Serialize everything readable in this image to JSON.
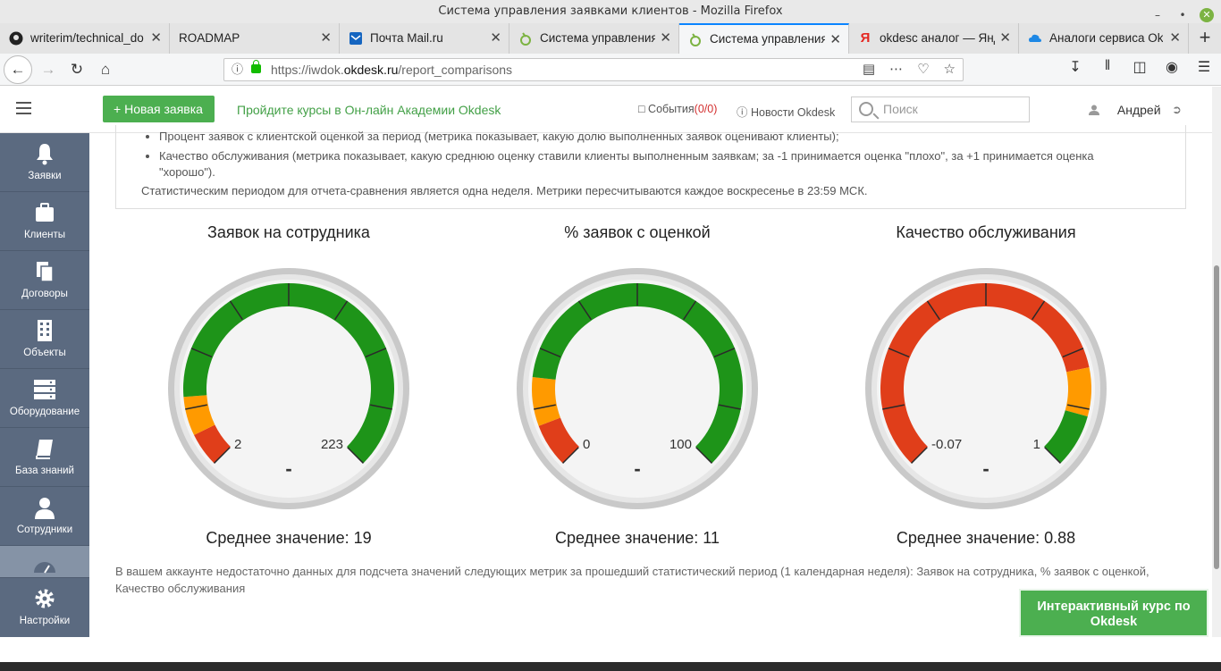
{
  "window": {
    "title": "Система управления заявками клиентов - Mozilla Firefox"
  },
  "tabs": [
    {
      "label": "writerim/technical_do"
    },
    {
      "label": "ROADMAP"
    },
    {
      "label": "Почта Mail.ru"
    },
    {
      "label": "Система управления"
    },
    {
      "label": "Система управления"
    },
    {
      "label": "okdesc аналог — Янд"
    },
    {
      "label": "Аналоги сервиса Ok"
    }
  ],
  "address": {
    "prefix": "https://iwdok.",
    "domain": "okdesk.ru",
    "path": "/report_comparisons"
  },
  "header": {
    "new_request": "Новая заявка",
    "courses_link": "Пройдите курсы в Он-лайн Академии Okdesk",
    "events_label": "События",
    "events_count": "(0/0)",
    "news_label": "Новости Okdesk",
    "search_placeholder": "Поиск",
    "user_name": "Андрей"
  },
  "sidebar": {
    "items": [
      {
        "label": "Заявки"
      },
      {
        "label": "Клиенты"
      },
      {
        "label": "Договоры"
      },
      {
        "label": "Объекты"
      },
      {
        "label": "Оборудование"
      },
      {
        "label": "База знаний"
      },
      {
        "label": "Сотрудники"
      },
      {
        "label": ""
      },
      {
        "label": "Настройки"
      }
    ]
  },
  "info": {
    "bullets": [
      "Процент заявок с клиентской оценкой за период (метрика показывает, какую долю выполненных заявок оценивают клиенты);",
      "Качество обслуживания (метрика показывает, какую среднюю оценку ставили клиенты выполненным заявкам; за -1 принимается оценка \"плохо\", за +1 принимается оценка \"хорошо\")."
    ],
    "note": "Статистическим периодом для отчета-сравнения является одна неделя. Метрики пересчитываются каждое воскресенье в 23:59 МСК."
  },
  "gauges": [
    {
      "title": "Заявок на сотрудника",
      "min": "2",
      "max": "223",
      "value": "-",
      "average": "Среднее значение: 19",
      "bands": [
        {
          "from": 0,
          "to": 0.07,
          "color": "#e03e1a"
        },
        {
          "from": 0.07,
          "to": 0.15,
          "color": "#ff9a00"
        },
        {
          "from": 0.15,
          "to": 1,
          "color": "#1e9419"
        }
      ]
    },
    {
      "title": "% заявок с оценкой",
      "min": "0",
      "max": "100",
      "value": "-",
      "average": "Среднее значение: 11",
      "bands": [
        {
          "from": 0,
          "to": 0.09,
          "color": "#e03e1a"
        },
        {
          "from": 0.09,
          "to": 0.19,
          "color": "#ff9a00"
        },
        {
          "from": 0.19,
          "to": 1,
          "color": "#1e9419"
        }
      ]
    },
    {
      "title": "Качество обслуживания",
      "min": "-0.07",
      "max": "1",
      "value": "-",
      "average": "Среднее значение: 0.88",
      "bands": [
        {
          "from": 0,
          "to": 0.79,
          "color": "#e03e1a"
        },
        {
          "from": 0.79,
          "to": 0.89,
          "color": "#ff9a00"
        },
        {
          "from": 0.89,
          "to": 1,
          "color": "#1e9419"
        }
      ]
    }
  ],
  "footer": {
    "message": "В вашем аккаунте недостаточно данных для подсчета значений следующих метрик за прошедший статистический период (1 календарная неделя): Заявок на сотрудника, % заявок с оценкой, Качество обслуживания",
    "course_button": "Интерактивный курс по Okdesk"
  }
}
